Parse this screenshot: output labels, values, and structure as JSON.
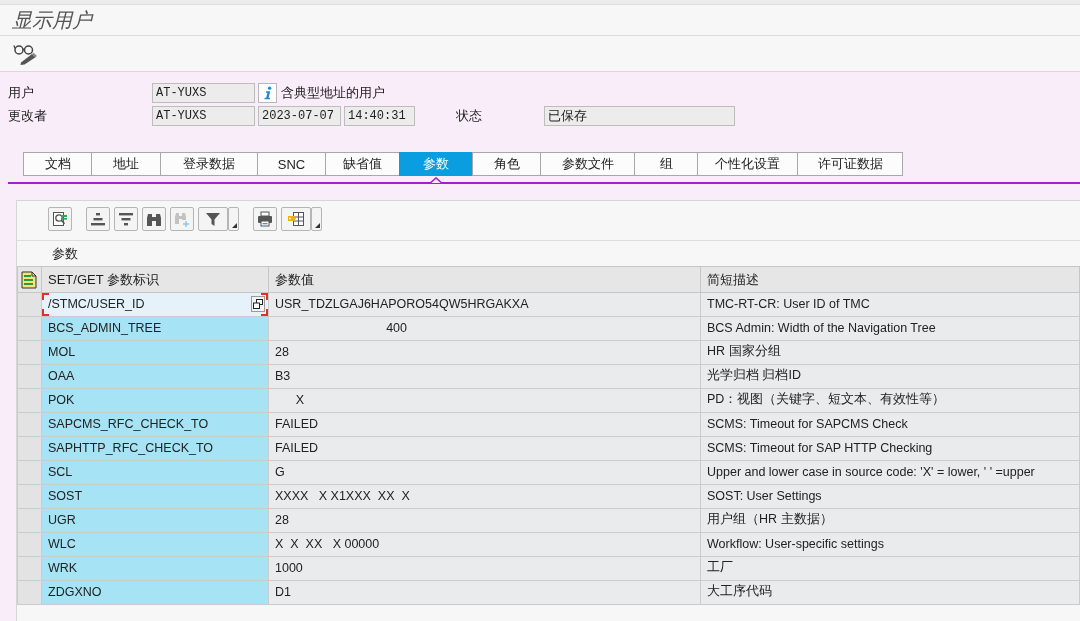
{
  "window": {
    "title": "显示用户"
  },
  "header": {
    "user": {
      "label": "用户",
      "value": "AT-YUXS",
      "description": "含典型地址的用户"
    },
    "changed_by": {
      "label": "更改者",
      "value": "AT-YUXS",
      "date": "2023-07-07",
      "time": "14:40:31"
    },
    "status": {
      "label": "状态",
      "value": "已保存"
    }
  },
  "tabs": [
    {
      "label": "文档",
      "selected": false
    },
    {
      "label": "地址",
      "selected": false
    },
    {
      "label": "登录数据",
      "selected": false
    },
    {
      "label": "SNC",
      "selected": false
    },
    {
      "label": "缺省值",
      "selected": false
    },
    {
      "label": "参数",
      "selected": true
    },
    {
      "label": "角色",
      "selected": false
    },
    {
      "label": "参数文件",
      "selected": false
    },
    {
      "label": "组",
      "selected": false
    },
    {
      "label": "个性化设置",
      "selected": false
    },
    {
      "label": "许可证数据",
      "selected": false
    }
  ],
  "parameters": {
    "toolbar": {
      "groups": [
        [
          {
            "kind": "details",
            "disabled": false,
            "has_menu": false
          }
        ],
        [
          {
            "kind": "sort-ascending",
            "disabled": false,
            "has_menu": false
          },
          {
            "kind": "sort-descending",
            "disabled": false,
            "has_menu": false
          },
          {
            "kind": "find",
            "disabled": false,
            "has_menu": false
          },
          {
            "kind": "find-next",
            "disabled": true,
            "has_menu": false
          },
          {
            "kind": "filter",
            "disabled": false,
            "has_menu": true
          }
        ],
        [
          {
            "kind": "print",
            "disabled": false,
            "has_menu": false
          },
          {
            "kind": "layout",
            "disabled": false,
            "has_menu": true
          }
        ]
      ]
    },
    "title": "参数",
    "table": {
      "columns": [
        "SET/GET 参数标识",
        "参数值",
        "简短描述"
      ],
      "rows": [
        {
          "parameter": "/STMC/USER_ID",
          "value": "USR_TDZLGAJ6HAPORO54QW5HRGAKXA",
          "description": "TMC-RT-CR: User ID of TMC",
          "focused": true
        },
        {
          "parameter": "BCS_ADMIN_TREE",
          "value": "                                400",
          "description": "BCS Admin: Width of the Navigation Tree",
          "focused": false
        },
        {
          "parameter": "MOL",
          "value": "28",
          "description": "HR 国家分组",
          "focused": false
        },
        {
          "parameter": "OAA",
          "value": "B3",
          "description": "光学归档 归档ID",
          "focused": false
        },
        {
          "parameter": "POK",
          "value": "      X",
          "description": "PD：视图（关键字、短文本、有效性等）",
          "focused": false
        },
        {
          "parameter": "SAPCMS_RFC_CHECK_TO",
          "value": "FAILED",
          "description": "SCMS: Timeout for SAPCMS Check",
          "focused": false
        },
        {
          "parameter": "SAPHTTP_RFC_CHECK_TO",
          "value": "FAILED",
          "description": "SCMS: Timeout for SAP HTTP Checking",
          "focused": false
        },
        {
          "parameter": "SCL",
          "value": "G",
          "description": "Upper and lower case in source code: 'X' = lower, ' ' =upper",
          "focused": false
        },
        {
          "parameter": "SOST",
          "value": "XXXX   X X1XXX  XX  X",
          "description": "SOST: User Settings",
          "focused": false
        },
        {
          "parameter": "UGR",
          "value": "28",
          "description": "用户组（HR 主数据）",
          "focused": false
        },
        {
          "parameter": "WLC",
          "value": "X  X  XX   X 00000",
          "description": "Workflow: User-specific settings",
          "focused": false
        },
        {
          "parameter": "WRK",
          "value": "1000",
          "description": "工厂",
          "focused": false
        },
        {
          "parameter": "ZDGXNO",
          "value": "D1",
          "description": "大工序代码",
          "focused": false
        }
      ]
    }
  }
}
